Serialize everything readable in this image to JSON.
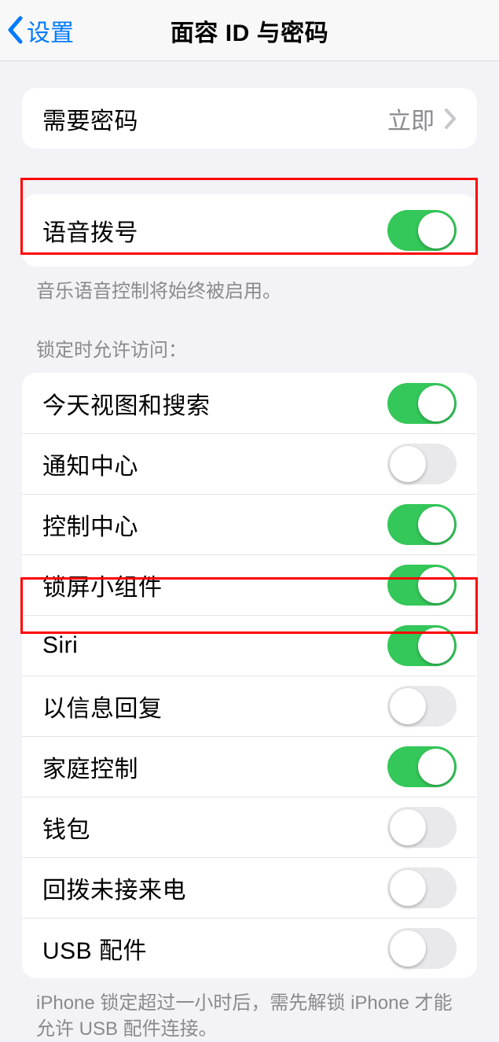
{
  "nav": {
    "back_label": "设置",
    "title": "面容 ID 与密码"
  },
  "passcode_group": {
    "require_label": "需要密码",
    "require_value": "立即"
  },
  "voice_dial": {
    "label": "语音拨号",
    "on": true,
    "caption": "音乐语音控制将始终被启用。"
  },
  "lock_header": "锁定时允许访问：",
  "lock_items": [
    {
      "label": "今天视图和搜索",
      "on": true
    },
    {
      "label": "通知中心",
      "on": false
    },
    {
      "label": "控制中心",
      "on": true
    },
    {
      "label": "锁屏小组件",
      "on": true
    },
    {
      "label": "Siri",
      "on": true
    },
    {
      "label": "以信息回复",
      "on": false
    },
    {
      "label": "家庭控制",
      "on": true
    },
    {
      "label": "钱包",
      "on": false
    },
    {
      "label": "回拨未接来电",
      "on": false
    },
    {
      "label": "USB 配件",
      "on": false
    }
  ],
  "lock_footer": "iPhone 锁定超过一小时后，需先解锁 iPhone 才能允许 USB 配件连接。"
}
